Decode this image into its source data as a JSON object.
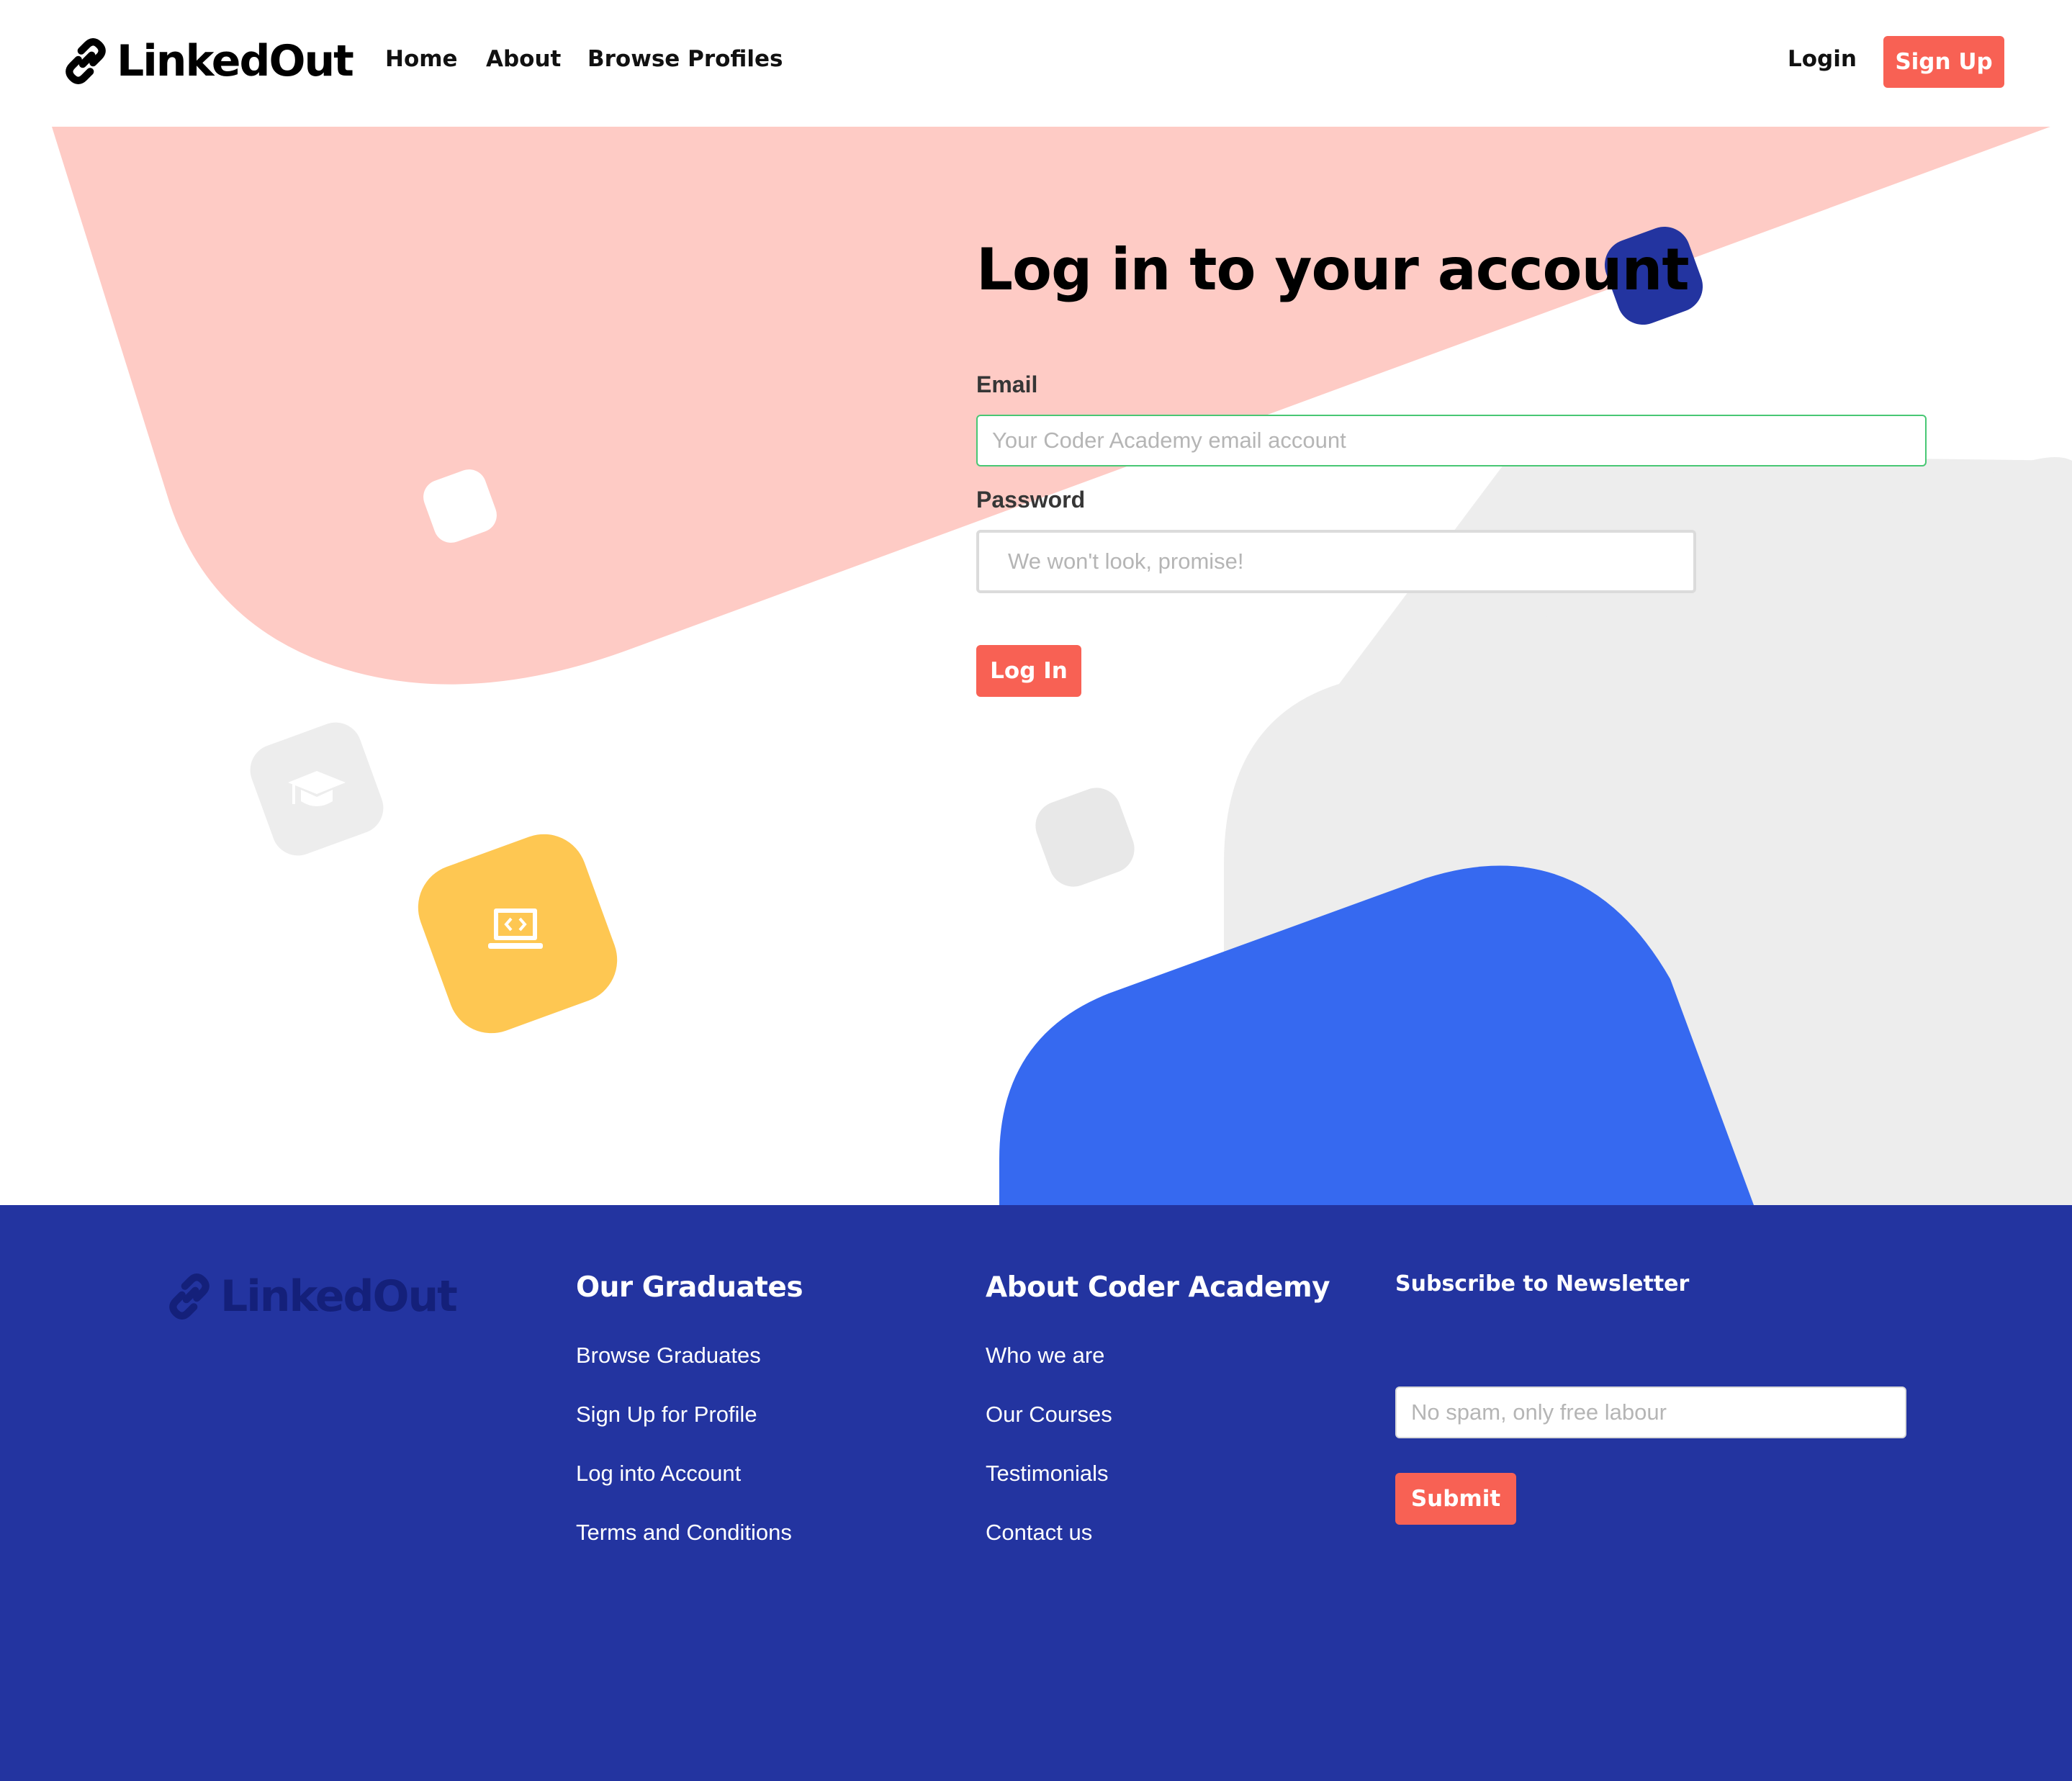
{
  "colors": {
    "primary_coral": "#f86154",
    "light_pink": "#fecbc5",
    "navy": "#2334a0",
    "dark_navy": "#14207a",
    "bright_blue": "#3669f0",
    "yellow": "#fec752",
    "light_gray": "#ededed",
    "success_green": "#48c774"
  },
  "nav": {
    "brand": "LinkedOut",
    "brand_icon": "link-icon",
    "links": [
      {
        "label": "Home"
      },
      {
        "label": "About"
      },
      {
        "label": "Browse Profiles"
      }
    ],
    "login_label": "Login",
    "signup_label": "Sign Up"
  },
  "decorations": {
    "graduation_icon": "graduation-cap-icon",
    "code_icon": "laptop-code-icon"
  },
  "login": {
    "title": "Log in to your account",
    "email_label": "Email",
    "email_placeholder": "Your Coder Academy email account",
    "password_label": "Password",
    "password_placeholder": "We won't look, promise!",
    "submit_label": "Log In"
  },
  "footer": {
    "brand": "LinkedOut",
    "brand_icon": "link-icon",
    "graduates": {
      "heading": "Our Graduates",
      "links": [
        "Browse Graduates",
        "Sign Up for Profile",
        "Log into Account",
        "Terms and Conditions"
      ]
    },
    "about": {
      "heading": "About Coder Academy",
      "links": [
        "Who we are",
        "Our Courses",
        "Testimonials",
        "Contact us"
      ]
    },
    "newsletter": {
      "heading": "Subscribe to Newsletter",
      "placeholder": "No spam, only free labour",
      "submit_label": "Submit"
    }
  }
}
